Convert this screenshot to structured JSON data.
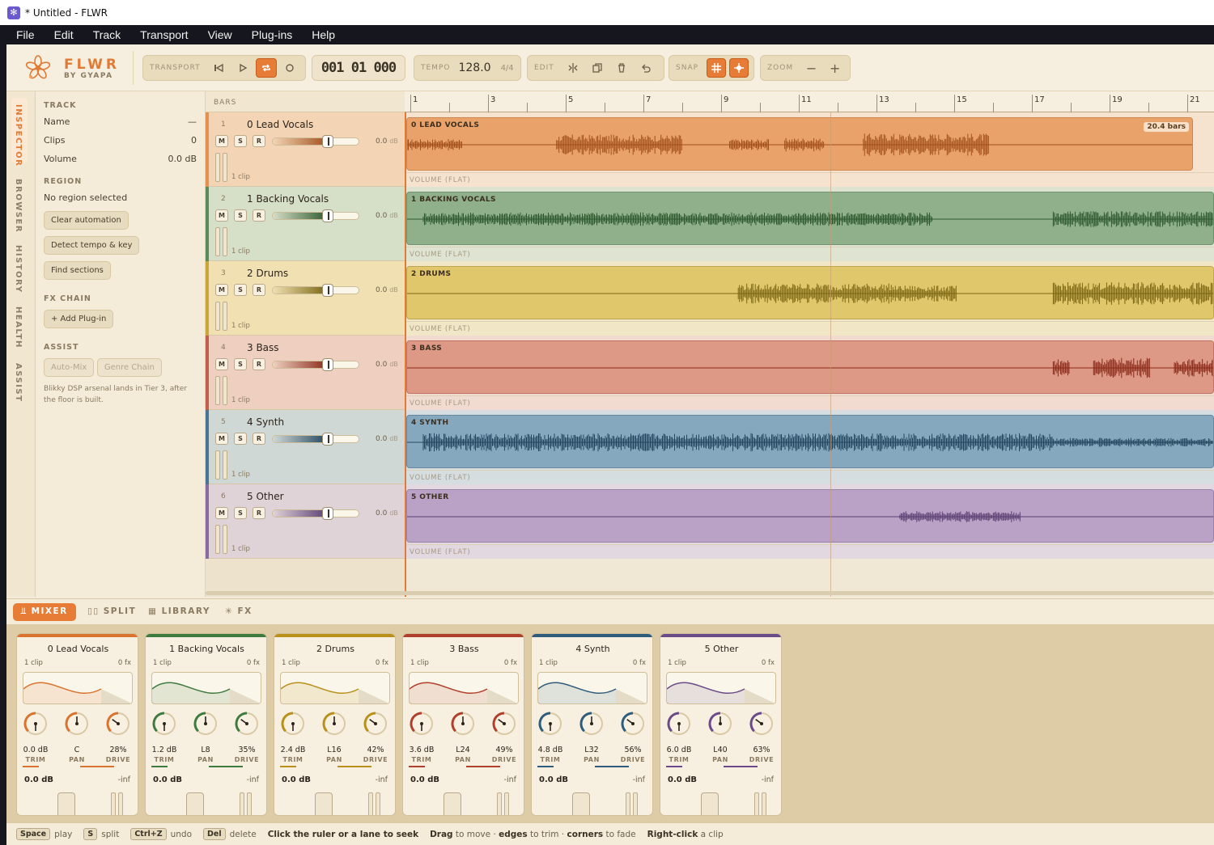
{
  "window": {
    "title": "* Untitled - FLWR"
  },
  "menu": [
    "File",
    "Edit",
    "Track",
    "Transport",
    "View",
    "Plug-ins",
    "Help"
  ],
  "brand": {
    "name": "FLWR",
    "sub": "BY GYAPA"
  },
  "toolbar": {
    "transport_label": "TRANSPORT",
    "counter": "001 01 000",
    "tempo_label": "TEMPO",
    "tempo": "128.0",
    "time_sig": "4/4",
    "edit_label": "EDIT",
    "snap_label": "SNAP",
    "zoom_label": "ZOOM",
    "zoom_out": "−",
    "zoom_in": "+"
  },
  "sidebar_tabs": [
    "INSPECTOR",
    "BROWSER",
    "HISTORY",
    "HEALTH",
    "ASSIST"
  ],
  "inspector": {
    "track_header": "TRACK",
    "name_label": "Name",
    "name_value": "—",
    "clips_label": "Clips",
    "clips_value": "0",
    "volume_label": "Volume",
    "volume_value": "0.0 dB",
    "region_header": "REGION",
    "region_text": "No region selected",
    "btn_clear_automation": "Clear automation",
    "btn_detect_tempo": "Detect tempo & key",
    "btn_find_sections": "Find sections",
    "fx_header": "FX CHAIN",
    "btn_add_plugin": "+ Add Plug-in",
    "assist_header": "ASSIST",
    "btn_automix": "Auto-Mix",
    "btn_genre_chain": "Genre Chain",
    "assist_note": "Blikky DSP arsenal lands in Tier 3, after the floor is built."
  },
  "bars_label": "BARS",
  "ruler_labels": [
    "1",
    "3",
    "5",
    "7",
    "9",
    "11",
    "13",
    "15",
    "17",
    "19",
    "21"
  ],
  "tracks": [
    {
      "num": "1",
      "name": "0 Lead Vocals",
      "db": "0.0",
      "unit": "dB",
      "clips": "1 clip",
      "clip_label": "0 LEAD VOCALS",
      "clip_len": "20.4 bars",
      "vol_label": "VOLUME (FLAT)",
      "color": "#e4914f",
      "head_bg": "#f3d5b6",
      "lane_bg": "#f5e3cf",
      "clip_bg": "#e8a26a",
      "wave": "#a24f1c",
      "m": "M",
      "s": "S",
      "r": "R"
    },
    {
      "num": "2",
      "name": "1 Backing Vocals",
      "db": "0.0",
      "unit": "dB",
      "clips": "1 clip",
      "clip_label": "1 BACKING VOCALS",
      "vol_label": "VOLUME (FLAT)",
      "color": "#5c8a5a",
      "head_bg": "#d6dfc8",
      "lane_bg": "#dfe4d2",
      "clip_bg": "#8fb08b",
      "wave": "#2f5a2f",
      "m": "M",
      "s": "S",
      "r": "R"
    },
    {
      "num": "3",
      "name": "2 Drums",
      "db": "0.0",
      "unit": "dB",
      "clips": "1 clip",
      "clip_label": "2 DRUMS",
      "vol_label": "VOLUME (FLAT)",
      "color": "#c9a636",
      "head_bg": "#f0e0b2",
      "lane_bg": "#f1e6c6",
      "clip_bg": "#e1c76c",
      "wave": "#7a6512",
      "m": "M",
      "s": "S",
      "r": "R"
    },
    {
      "num": "4",
      "name": "3 Bass",
      "db": "0.0",
      "unit": "dB",
      "clips": "1 clip",
      "clip_label": "3 BASS",
      "vol_label": "VOLUME (FLAT)",
      "color": "#c0604c",
      "head_bg": "#efd0c0",
      "lane_bg": "#f1dbd0",
      "clip_bg": "#dd9886",
      "wave": "#8a2818",
      "m": "M",
      "s": "S",
      "r": "R"
    },
    {
      "num": "5",
      "name": "4 Synth",
      "db": "0.0",
      "unit": "dB",
      "clips": "1 clip",
      "clip_label": "4 SYNTH",
      "vol_label": "VOLUME (FLAT)",
      "color": "#4a7496",
      "head_bg": "#d0d8d6",
      "lane_bg": "#d6dde0",
      "clip_bg": "#86a8bf",
      "wave": "#23475f",
      "m": "M",
      "s": "S",
      "r": "R"
    },
    {
      "num": "6",
      "name": "5 Other",
      "db": "0.0",
      "unit": "dB",
      "clips": "1 clip",
      "clip_label": "5 OTHER",
      "vol_label": "VOLUME (FLAT)",
      "color": "#8a6aa0",
      "head_bg": "#e0d3d8",
      "lane_bg": "#e2d8df",
      "clip_bg": "#baa2c6",
      "wave": "#5a3e72",
      "m": "M",
      "s": "S",
      "r": "R"
    }
  ],
  "bottom_tabs": [
    "MIXER",
    "SPLIT",
    "LIBRARY",
    "FX"
  ],
  "strips": [
    {
      "name": "0 Lead Vocals",
      "clips": "1 clip",
      "fx": "0 fx",
      "trim": "0.0 dB",
      "pan": "C",
      "drive": "28%",
      "db": "0.0 dB",
      "inf": "-inf",
      "color": "#d9742f"
    },
    {
      "name": "1 Backing Vocals",
      "clips": "1 clip",
      "fx": "0 fx",
      "trim": "1.2 dB",
      "pan": "L8",
      "drive": "35%",
      "db": "0.0 dB",
      "inf": "-inf",
      "color": "#3f7a3f"
    },
    {
      "name": "2 Drums",
      "clips": "1 clip",
      "fx": "0 fx",
      "trim": "2.4 dB",
      "pan": "L16",
      "drive": "42%",
      "db": "0.0 dB",
      "inf": "-inf",
      "color": "#b8901a"
    },
    {
      "name": "3 Bass",
      "clips": "1 clip",
      "fx": "0 fx",
      "trim": "3.6 dB",
      "pan": "L24",
      "drive": "49%",
      "db": "0.0 dB",
      "inf": "-inf",
      "color": "#b0402c"
    },
    {
      "name": "4 Synth",
      "clips": "1 clip",
      "fx": "0 fx",
      "trim": "4.8 dB",
      "pan": "L32",
      "drive": "56%",
      "db": "0.0 dB",
      "inf": "-inf",
      "color": "#2f5c7c"
    },
    {
      "name": "5 Other",
      "clips": "1 clip",
      "fx": "0 fx",
      "trim": "6.0 dB",
      "pan": "L40",
      "drive": "63%",
      "db": "0.0 dB",
      "inf": "-inf",
      "color": "#6a4a88"
    }
  ],
  "knob_labels": {
    "trim": "TRIM",
    "pan": "PAN",
    "drive": "DRIVE"
  },
  "status": {
    "k1": "Space",
    "t1": "play",
    "k2": "S",
    "t2": "split",
    "k3": "Ctrl+Z",
    "t3": "undo",
    "k4": "Del",
    "t4": "delete",
    "seek": "Click the ruler or a lane to seek",
    "drag": "Drag",
    "drag_t": "to move ·",
    "edges": "edges",
    "edges_t": "to trim ·",
    "corners": "corners",
    "corners_t": "to fade",
    "rclick": "Right-click",
    "rclick_t": "a clip"
  }
}
